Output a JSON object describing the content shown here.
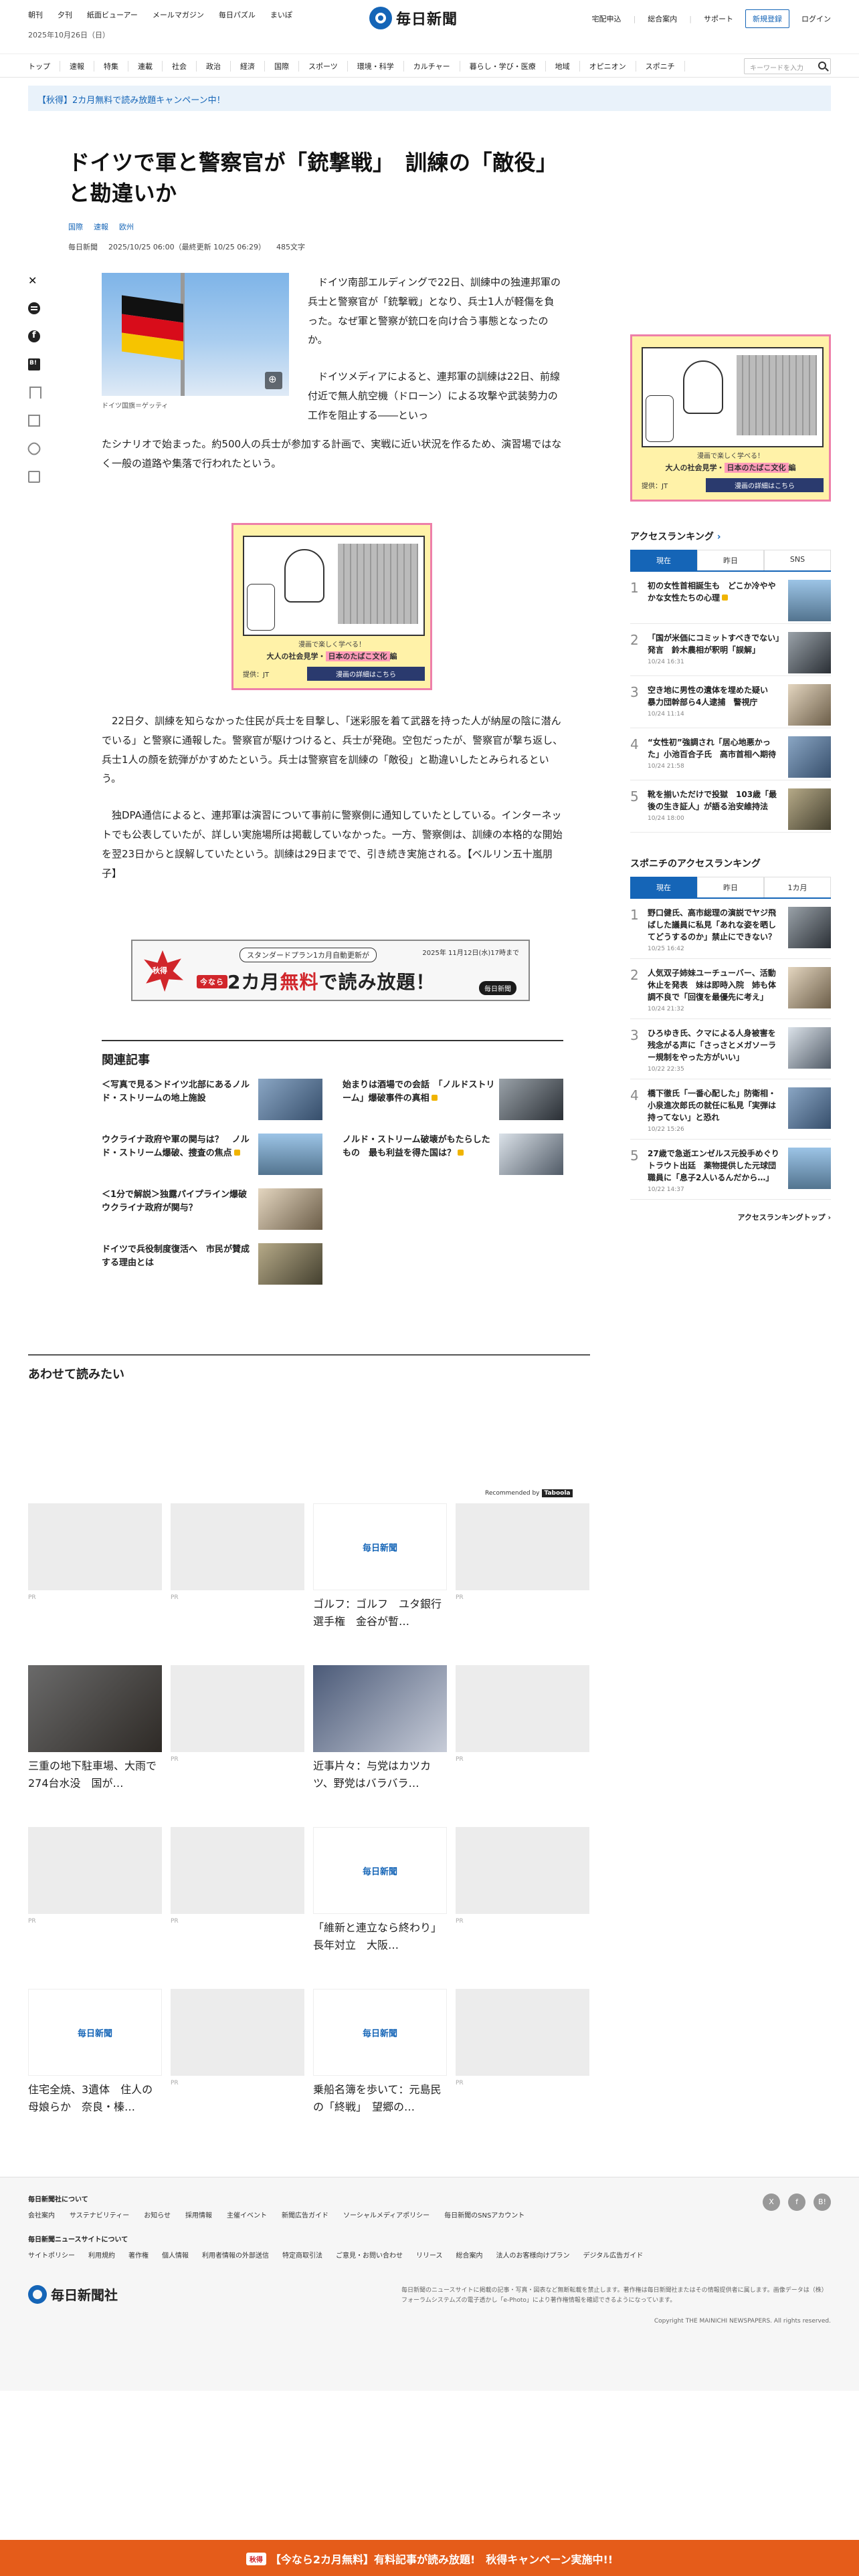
{
  "header": {
    "util_nav": [
      "朝刊",
      "夕刊",
      "紙面ビューアー",
      "メールマガジン",
      "毎日パズル",
      "まいぽ"
    ],
    "date": "2025年10月26日（日）",
    "logo": "毎日新聞",
    "right_nav": [
      "宅配申込",
      "総合案内",
      "サポート"
    ],
    "register_label": "新規登録",
    "login_label": "ログイン",
    "categories": [
      "トップ",
      "速報",
      "特集",
      "連載",
      "社会",
      "政治",
      "経済",
      "国際",
      "スポーツ",
      "環境・科学",
      "カルチャー",
      "暮らし・学び・医療",
      "地域",
      "オピニオン",
      "スポニチ"
    ],
    "search_placeholder": "キーワードを入力",
    "campaign": "【秋得】2カ月無料で読み放題キャンペーン中！"
  },
  "article": {
    "title": "ドイツで軍と警察官が「銃撃戦」　訓練の「敵役」と勘違いか",
    "tags": [
      "国際",
      "速報",
      "欧州"
    ],
    "source": "毎日新聞",
    "datetime": "2025/10/25 06:00（最終更新 10/25 06:29）",
    "chars": "485文字",
    "photo_caption": "ドイツ国旗＝ゲッティ",
    "para1": "ドイツ南部エルディングで22日、訓練中の独連邦軍の兵士と警察官が「銃撃戦」となり、兵士1人が軽傷を負った。なぜ軍と警察が銃口を向け合う事態となったのか。",
    "para2a": "ドイツメディアによると、連邦軍の訓練は22日、前線付近で無人航空機（ドローン）による攻撃や武装勢力の工作を阻止する――といっ",
    "para2b": "たシナリオで始まった。約500人の兵士が参加する計画で、実戦に近い状況を作るため、演習場ではなく一般の道路や集落で行われたという。",
    "para3": "22日夕、訓練を知らなかった住民が兵士を目撃し、「迷彩服を着て武器を持った人が納屋の陰に潜んでいる」と警察に通報した。警察官が駆けつけると、兵士が発砲。空包だったが、警察官が撃ち返し、兵士1人の顔を銃弾がかすめたという。兵士は警察官を訓練の「敵役」と勘違いしたとみられるという。",
    "para4": "独DPA通信によると、連邦軍は演習について事前に警察側に通知していたとしている。インターネットでも公表していたが、詳しい実施場所は掲載していなかった。一方、警察側は、訓練の本格的な開始を翌23日からと誤解していたという。訓練は29日までで、引き続き実施される。【ベルリン五十嵐朋子】"
  },
  "ad": {
    "line1": "漫画で楽しく学べる！",
    "line2_prefix": "大人の社会見学・",
    "line2_highlight": "日本のたばこ文化",
    "line2_suffix": "編",
    "sponsor": "提供：JT",
    "cta": "漫画の詳細はこちら"
  },
  "banner": {
    "badge": "秋得",
    "standard": "スタンダードプラン1カ月自動更新が",
    "gift": "今なら",
    "main_prefix": "2カ月",
    "main_red": "無料",
    "main_suffix": "で読み放題！",
    "date": "2025年 11月12日(水)17時まで",
    "logo": "毎日新聞"
  },
  "related": {
    "heading": "関連記事",
    "items": [
      {
        "title": "＜写真で見る＞ドイツ北部にあるノルド・ストリームの地上施設"
      },
      {
        "title": "始まりは酒場での会話　「ノルドストリーム」爆破事件の真相"
      },
      {
        "title": "ウクライナ政府や軍の関与は？　ノルド・ストリーム爆破、捜査の焦点"
      },
      {
        "title": "ノルド・ストリーム破壊がもたらしたもの　最も利益を得た国は？"
      },
      {
        "title": "＜1分で解説＞独露パイプライン爆破　ウクライナ政府が関与？"
      },
      {
        "title": "ドイツで兵役制度復活へ　市民が賛成する理由とは"
      }
    ]
  },
  "ranking": {
    "heading": "アクセスランキング",
    "tabs": [
      "現在",
      "昨日",
      "SNS"
    ],
    "items": [
      {
        "n": "1",
        "title": "初の女性首相誕生も　どこか冷ややかな女性たちの心理",
        "time": ""
      },
      {
        "n": "2",
        "title": "「国が米価にコミットすべきでない」発言　鈴木農相が釈明「誤解」",
        "time": "10/24 16:31"
      },
      {
        "n": "3",
        "title": "空き地に男性の遺体を埋めた疑い　暴力団幹部ら4人逮捕　警視庁",
        "time": "10/24 11:14"
      },
      {
        "n": "4",
        "title": "“女性初”強調され「居心地悪かった」小池百合子氏　高市首相へ期待",
        "time": "10/24 21:58"
      },
      {
        "n": "5",
        "title": "靴を揃いただけで投獄　103歳「最後の生き証人」が語る治安維持法",
        "time": "10/24 18:00"
      }
    ],
    "heading2": "スポニチのアクセスランキング",
    "tabs2": [
      "現在",
      "昨日",
      "1カ月"
    ],
    "items2": [
      {
        "n": "1",
        "title": "野口健氏、高市総理の演説でヤジ飛ばした議員に私見「あれな姿を晒してどうするのか」禁止にできない？",
        "time": "10/25 16:42"
      },
      {
        "n": "2",
        "title": "人気双子姉妹ユーチューバー、活動休止を発表　妹は即時入院　姉も体調不良で「回復を最優先に考え」",
        "time": "10/24 21:32"
      },
      {
        "n": "3",
        "title": "ひろゆき氏、クマによる人身被害を残念がる声に「さっさとメガソーラー規制をやった方がいい」",
        "time": "10/22 22:35"
      },
      {
        "n": "4",
        "title": "橋下徹氏「一番心配した」防衛相・小泉進次郎氏の就任に私見「実弾は持ってない」と恐れ",
        "time": "10/22 15:26"
      },
      {
        "n": "5",
        "title": "27歳で急逝エンゼルス元投手めぐりトラウト出廷　薬物提供した元球団職員に「息子2人いるんだから…」",
        "time": "10/22 14:37"
      }
    ],
    "more": "アクセスランキングトップ"
  },
  "recommend": {
    "heading": "あわせて読みたい",
    "by": "Recommended by",
    "by_brand": "Taboola",
    "pr": "PR",
    "cards": [
      "ゴルフ：ゴルフ　ユタ銀行選手権　金谷が暫…",
      "三重の地下駐車場、大雨で274台水没　国が…",
      "近事片々：与党はカツカツ、野党はバラバラ…",
      "「維新と連立なら終わり」　長年対立　大阪…",
      "住宅全焼、3遺体　住人の母娘らか　奈良・榛…",
      "乗船名簿を歩いて：元島民の「終戦」　望郷の…"
    ]
  },
  "footer": {
    "about": "毎日新聞社について",
    "links1": [
      "会社案内",
      "サステナビリティー",
      "お知らせ",
      "採用情報",
      "主催イベント",
      "新聞広告ガイド",
      "ソーシャルメディアポリシー",
      "毎日新聞のSNSアカウント"
    ],
    "about2": "毎日新聞ニュースサイトについて",
    "links2": [
      "サイトポリシー",
      "利用規約",
      "著作権",
      "個人情報",
      "利用者情報の外部送信",
      "特定商取引法",
      "ご意見・お問い合わせ",
      "リリース",
      "総合案内",
      "法人のお客様向けプラン",
      "デジタル広告ガイド"
    ],
    "logo": "毎日新聞社",
    "notice": "毎日新聞のニュースサイトに掲載の記事・写真・図表など無断転載を禁止します。著作権は毎日新聞社またはその情報提供者に属します。画像データは（株）フォーラムシステムズの電子透かし「e-Photo」により著作権情報を確認できるようになっています。",
    "copyright": "Copyright THE MAINICHI NEWSPAPERS. All rights reserved."
  },
  "fixed_bar": {
    "badge": "秋得",
    "text": "【今なら2カ月無料】有料記事が読み放題!　秋得キャンペーン実施中!!"
  }
}
